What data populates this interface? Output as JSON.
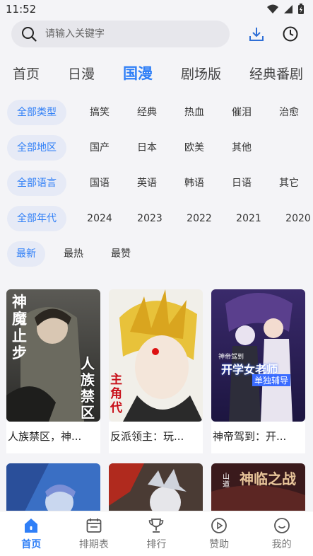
{
  "status": {
    "time": "11:52"
  },
  "search": {
    "placeholder": "请输入关键字"
  },
  "tabs": [
    {
      "label": "首页"
    },
    {
      "label": "日漫"
    },
    {
      "label": "国漫"
    },
    {
      "label": "剧场版"
    },
    {
      "label": "经典番剧"
    }
  ],
  "filters": {
    "type": [
      "全部类型",
      "搞笑",
      "经典",
      "热血",
      "催泪",
      "治愈"
    ],
    "region": [
      "全部地区",
      "国产",
      "日本",
      "欧美",
      "其他"
    ],
    "language": [
      "全部语言",
      "国语",
      "英语",
      "韩语",
      "日语",
      "其它"
    ],
    "year": [
      "全部年代",
      "2024",
      "2023",
      "2022",
      "2021",
      "2020"
    ],
    "sort": [
      "最新",
      "最热",
      "最赞"
    ]
  },
  "cards": [
    {
      "title": "人族禁区，神...",
      "cover_text_a": "神魔止步",
      "cover_text_b": "人族禁区"
    },
    {
      "title": "反派领主：玩...",
      "cover_text_a": "主角代"
    },
    {
      "title": "神帝驾到：开...",
      "cover_text_a": "神帝驾到",
      "cover_text_b": "开学女老师",
      "cover_text_c": "单独辅导"
    }
  ],
  "cards_row2": [
    {
      "cover_text_a": ""
    },
    {
      "cover_text_a": ""
    },
    {
      "cover_text_a": "神临之战",
      "cover_text_b": "山道"
    }
  ],
  "nav": [
    {
      "label": "首页",
      "icon": "home-icon"
    },
    {
      "label": "排期表",
      "icon": "calendar-icon"
    },
    {
      "label": "排行",
      "icon": "trophy-icon"
    },
    {
      "label": "赞助",
      "icon": "play-circle-icon"
    },
    {
      "label": "我的",
      "icon": "smile-icon"
    }
  ],
  "colors": {
    "accent": "#2f7ff7",
    "chip_bg": "#e6eaf6",
    "page_bg": "#f4f4f7"
  }
}
